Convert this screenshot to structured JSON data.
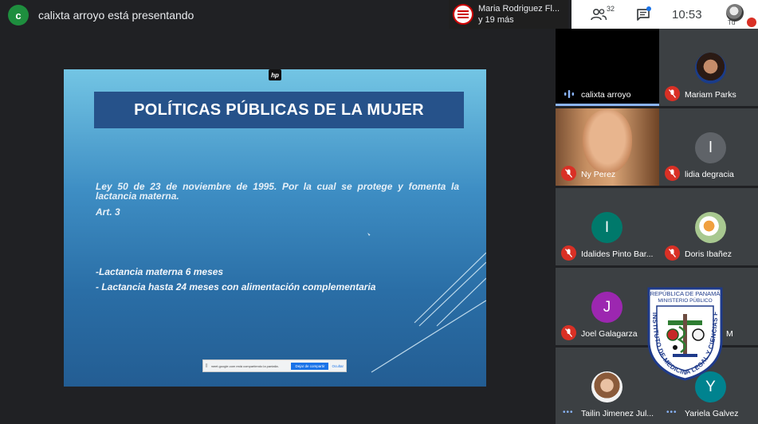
{
  "presenter_bar": {
    "avatar_letter": "c",
    "text": "calixta arroyo está presentando"
  },
  "raise_chip": {
    "line1": "Maria Rodriguez Fl...",
    "line2": "y 19 más"
  },
  "top_bar": {
    "people_count": "32",
    "clock": "10:53",
    "self_label": "Tú"
  },
  "slide": {
    "title": "POLÍTICAS PÚBLICAS DE LA MUJER",
    "law_text": "Ley 50 de 23 de noviembre de 1995. Por la cual se protege y fomenta la lactancia materna.",
    "article": "Art. 3",
    "bullets": [
      "-Lactancia materna 6 meses",
      "- Lactancia hasta 24 meses con alimentación complementaria"
    ],
    "share_bar": {
      "text": "meet.google.com está compartiendo la pantalla.",
      "stop_label": "Dejar de compartir",
      "hide_label": "Ocultar"
    }
  },
  "participants": [
    {
      "name": "calixta arroyo",
      "state": "speaking"
    },
    {
      "name": "Mariam Parks",
      "state": "muted"
    },
    {
      "name": "Ny Perez",
      "state": "muted"
    },
    {
      "name": "lidia degracia",
      "state": "muted",
      "initial": "l",
      "color": "#5f6368"
    },
    {
      "name": "Idalides Pinto Bar...",
      "state": "muted",
      "initial": "I",
      "color": "#00796b"
    },
    {
      "name": "Doris Ibañez",
      "state": "muted"
    },
    {
      "name": "Joel Galagarza",
      "state": "muted",
      "initial": "J",
      "color": "#9c27b0"
    },
    {
      "name": "M",
      "state": "muted"
    },
    {
      "name": "Tailin Jimenez Jul...",
      "state": "dots"
    },
    {
      "name": "Yariela Galvez",
      "state": "dots",
      "initial": "Y",
      "color": "#00838f"
    }
  ],
  "seal": {
    "top_text": "REPÚBLICA DE PANAMÁ",
    "sub_text": "MINISTERIO PÚBLICO",
    "ring_text": "INSTITUTO DE MEDICINA LEGAL Y CIENCIAS FORENSES"
  },
  "colors": {
    "meet_bg": "#202124",
    "tile_bg": "#3c4043",
    "mic_off_red": "#d93025",
    "speaking_blue": "#8ab4f8",
    "slide_title_bg": "#26528a"
  }
}
